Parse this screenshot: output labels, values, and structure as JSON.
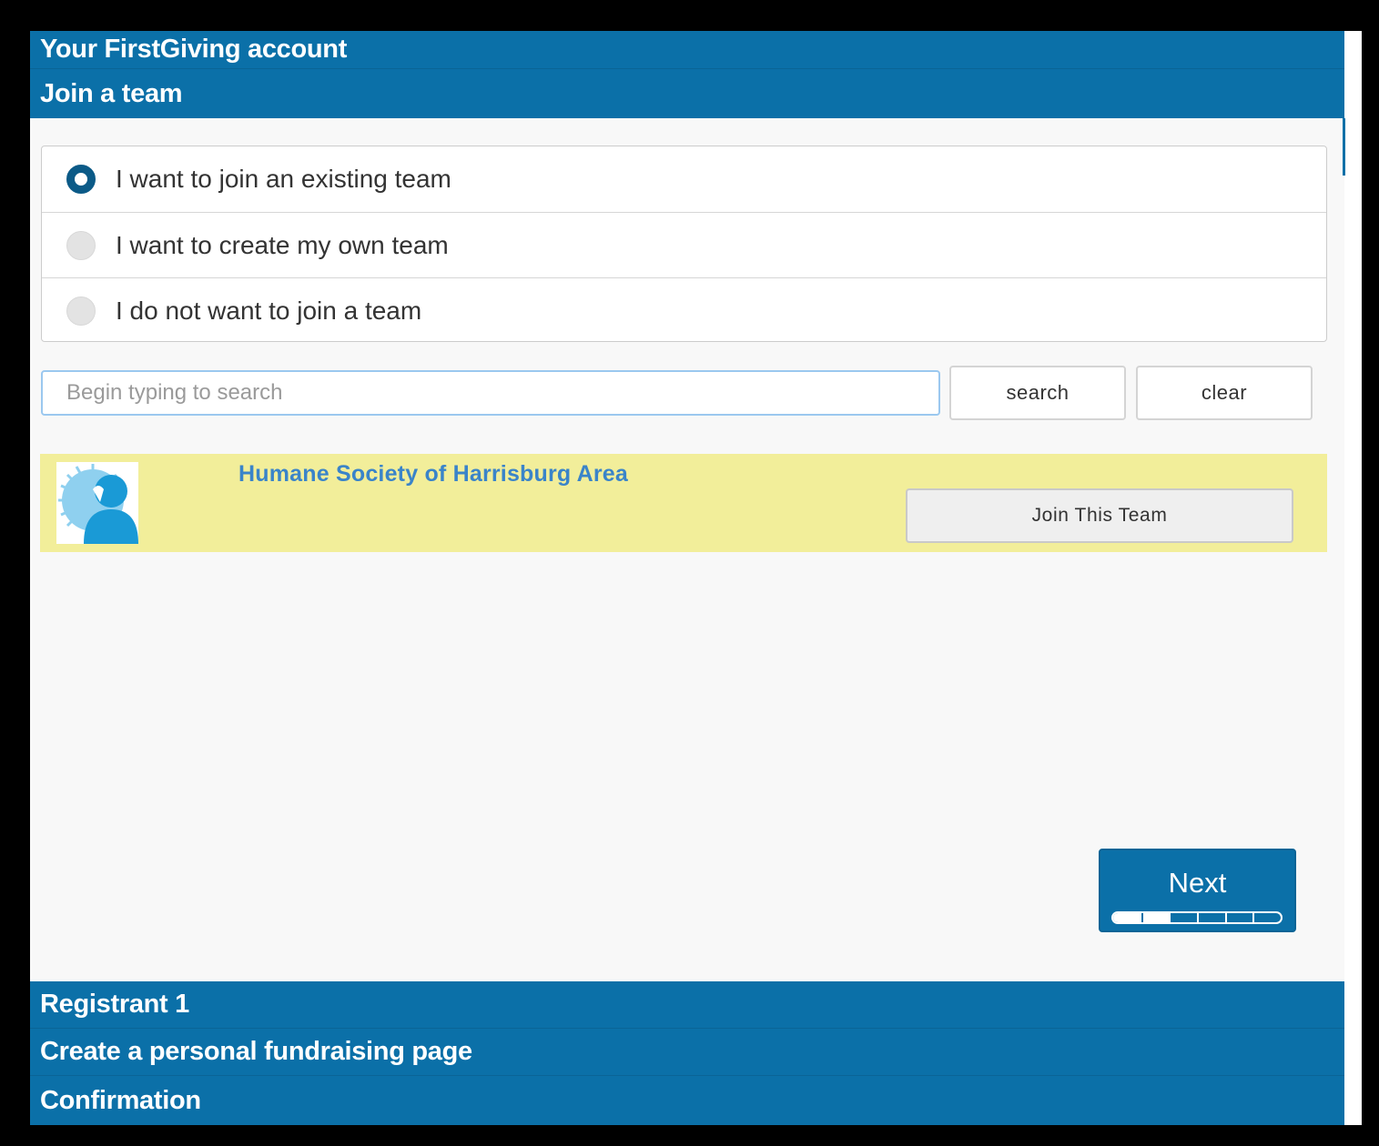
{
  "accordion": {
    "top_sections": [
      {
        "label": "Your FirstGiving account"
      },
      {
        "label": "Join a team"
      }
    ],
    "bottom_sections": [
      {
        "label": "Registrant 1"
      },
      {
        "label": "Create a personal fundraising page"
      },
      {
        "label": "Confirmation"
      }
    ]
  },
  "team_options": {
    "selected_index": 0,
    "items": [
      {
        "label": "I want to join an existing team"
      },
      {
        "label": "I want to create my own team"
      },
      {
        "label": "I do not want to join a team"
      }
    ]
  },
  "search": {
    "placeholder": "Begin typing to search",
    "value": "",
    "search_label": "search",
    "clear_label": "clear"
  },
  "results": [
    {
      "team_name": "Humane Society of Harrisburg Area",
      "join_label": "Join This Team",
      "avatar_icon": "default-user-icon"
    }
  ],
  "footer": {
    "next_label": "Next",
    "progress": {
      "current_step": 2,
      "total_steps": 6
    }
  },
  "colors": {
    "header_blue": "#0b70a8",
    "result_highlight": "#f2ee9a",
    "team_link": "#3a84c9"
  }
}
